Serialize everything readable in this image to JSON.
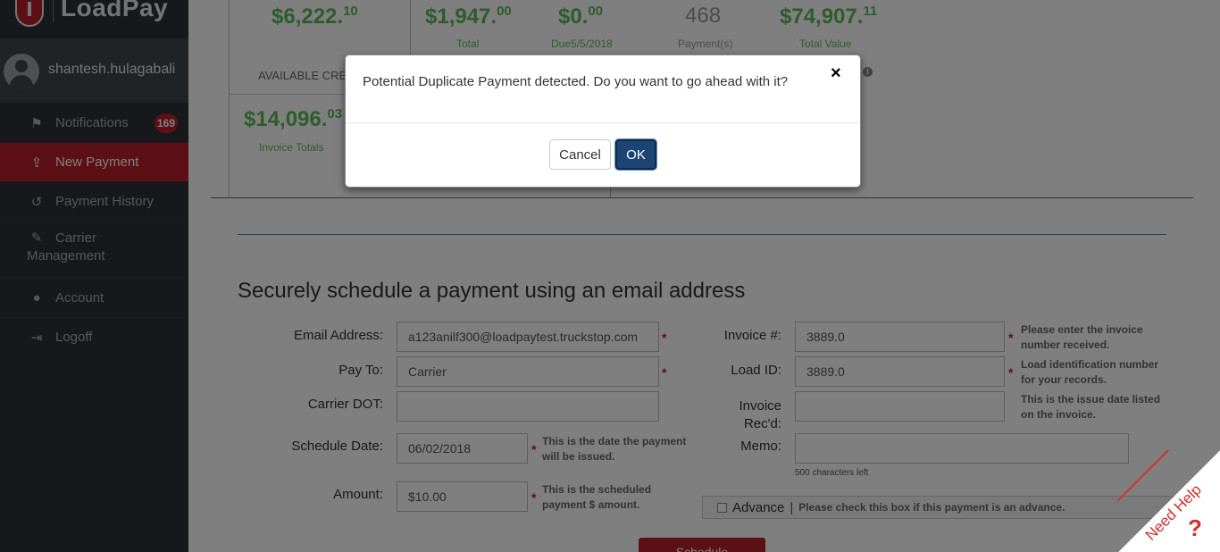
{
  "app": {
    "logo_text": "LoadPay"
  },
  "user": {
    "name": "shantesh.hulagabali"
  },
  "sidebar": {
    "items": [
      {
        "label": "Notifications",
        "icon": "flag-icon",
        "badge": "169"
      },
      {
        "label": "New Payment",
        "icon": "upload-icon"
      },
      {
        "label": "Payment History",
        "icon": "history-icon"
      },
      {
        "label": "Carrier Management",
        "icon": "wrench-icon"
      },
      {
        "label": "Account",
        "icon": "user-icon"
      },
      {
        "label": "Logoff",
        "icon": "logout-icon"
      }
    ]
  },
  "stats": {
    "available_credit": {
      "value": "$6,222.",
      "cents": "10",
      "label": "AVAILABLE CRE"
    },
    "invoice_totals": {
      "value": "$14,096.",
      "cents": "03",
      "label": "Invoice Totals"
    },
    "total": {
      "value": "$1,947.",
      "cents": "00",
      "label": "Total"
    },
    "due": {
      "value": "$0.",
      "cents": "00",
      "label": "Due5/5/2018"
    },
    "payments": {
      "value": "468",
      "label": "Payment(s)"
    },
    "total_value": {
      "value": "$74,907.",
      "cents": "11",
      "label": "Total Value"
    }
  },
  "form": {
    "title": "Securely schedule a payment using an email address",
    "email_label": "Email Address:",
    "email_value": "a123anilf300@loadpaytest.truckstop.com",
    "payto_label": "Pay To:",
    "payto_value": "Carrier",
    "dot_label": "Carrier DOT:",
    "dot_value": "",
    "schedule_label": "Schedule Date:",
    "schedule_value": "06/02/2018",
    "schedule_help": "This is the date the payment will be issued.",
    "amount_label": "Amount:",
    "amount_value": "$10.00",
    "amount_help": "This is the scheduled payment $ amount.",
    "invoice_label": "Invoice #:",
    "invoice_value": "3889.0",
    "invoice_help": "Please enter the invoice number received.",
    "load_label": "Load ID:",
    "load_value": "3889.0",
    "load_help": "Load identification number for your records.",
    "recd_label_1": "Invoice",
    "recd_label_2": "Rec'd:",
    "recd_value": "",
    "recd_help": "This is the issue date listed on the invoice.",
    "memo_label": "Memo:",
    "memo_value": "",
    "memo_note": "500 characters left",
    "advance_label": "Advance",
    "advance_sep": "|",
    "advance_help": "Please check this box if this payment is an advance.",
    "schedule_button": "Schedule",
    "required_mark": "*"
  },
  "modal": {
    "message": "Potential Duplicate Payment detected. Do you want to go ahead with it?",
    "close": "×",
    "cancel_label": "Cancel",
    "ok_label": "OK"
  },
  "need_help": {
    "label": "Need Help",
    "q": "?"
  }
}
